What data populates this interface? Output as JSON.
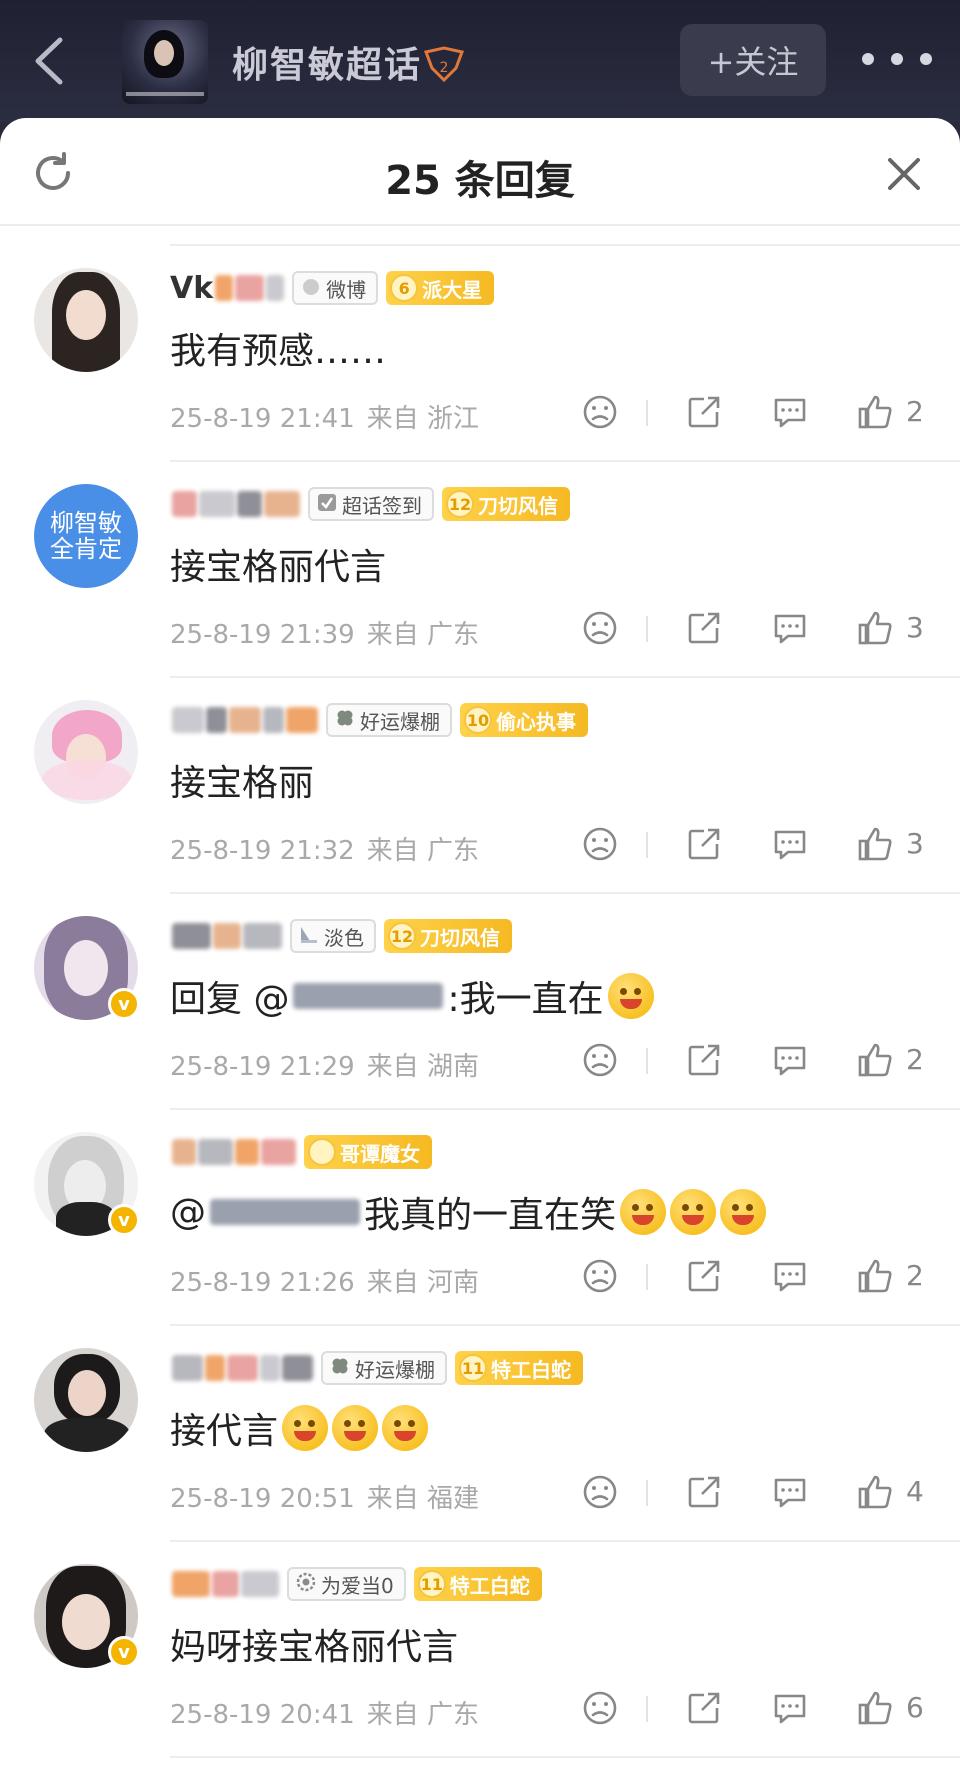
{
  "header": {
    "topic_title": "柳智敏超话",
    "topic_level": "2",
    "follow_label": "+关注"
  },
  "panel": {
    "title": "25 条回复"
  },
  "comments": [
    {
      "username": "Vk",
      "tags": [
        {
          "kind": "grey",
          "label": "微博",
          "icon": "weibo-icon"
        },
        {
          "kind": "gold",
          "level": "6",
          "label": "派大星"
        }
      ],
      "text": "我有预感……",
      "time": "25-8-19 21:41",
      "location_prefix": "来自",
      "location": "浙江",
      "likes": "2",
      "verified": false,
      "avatar_style": "girl-dark-hair"
    },
    {
      "username": "",
      "tags": [
        {
          "kind": "grey",
          "label": "超话签到",
          "icon": "checkin-icon"
        },
        {
          "kind": "gold",
          "level": "12",
          "label": "刀切风信"
        }
      ],
      "text": "接宝格丽代言",
      "time": "25-8-19 21:39",
      "location_prefix": "来自",
      "location": "广东",
      "likes": "3",
      "verified": false,
      "avatar_style": "text-avatar",
      "avatar_text": "柳智敏全肯定"
    },
    {
      "username": "",
      "tags": [
        {
          "kind": "grey",
          "label": "好运爆棚",
          "icon": "clover-icon"
        },
        {
          "kind": "gold",
          "level": "10",
          "label": "偷心执事"
        }
      ],
      "text": "接宝格丽",
      "time": "25-8-19 21:32",
      "location_prefix": "来自",
      "location": "广东",
      "likes": "3",
      "verified": false,
      "avatar_style": "pink-hair"
    },
    {
      "username": "",
      "tags": [
        {
          "kind": "grey",
          "label": "淡色",
          "icon": "book-icon"
        },
        {
          "kind": "gold",
          "level": "12",
          "label": "刀切风信"
        }
      ],
      "text_prefix": "回复 @",
      "text": ":我一直在",
      "time": "25-8-19 21:29",
      "location_prefix": "来自",
      "location": "湖南",
      "likes": "2",
      "verified": true,
      "avatar_style": "anime-purple",
      "emojis": 1
    },
    {
      "username": "",
      "tags": [
        {
          "kind": "gold",
          "level": "",
          "label": "哥谭魔女"
        }
      ],
      "text_prefix": "@",
      "text": "我真的一直在笑",
      "time": "25-8-19 21:26",
      "location_prefix": "来自",
      "location": "河南",
      "likes": "2",
      "verified": true,
      "avatar_style": "blonde-bw",
      "emojis": 3
    },
    {
      "username": "",
      "tags": [
        {
          "kind": "grey",
          "label": "好运爆棚",
          "icon": "clover-icon"
        },
        {
          "kind": "gold",
          "level": "11",
          "label": "特工白蛇"
        }
      ],
      "text": "接代言",
      "time": "25-8-19 20:51",
      "location_prefix": "来自",
      "location": "福建",
      "likes": "4",
      "verified": false,
      "avatar_style": "dark-girl",
      "emojis": 3
    },
    {
      "username": "",
      "tags": [
        {
          "kind": "grey",
          "label": "为爱当0",
          "icon": "gear-icon"
        },
        {
          "kind": "gold",
          "level": "11",
          "label": "特工白蛇"
        }
      ],
      "text": "妈呀接宝格丽代言",
      "time": "25-8-19 20:41",
      "location_prefix": "来自",
      "location": "广东",
      "likes": "6",
      "verified": true,
      "avatar_style": "girl-bangs"
    }
  ]
}
